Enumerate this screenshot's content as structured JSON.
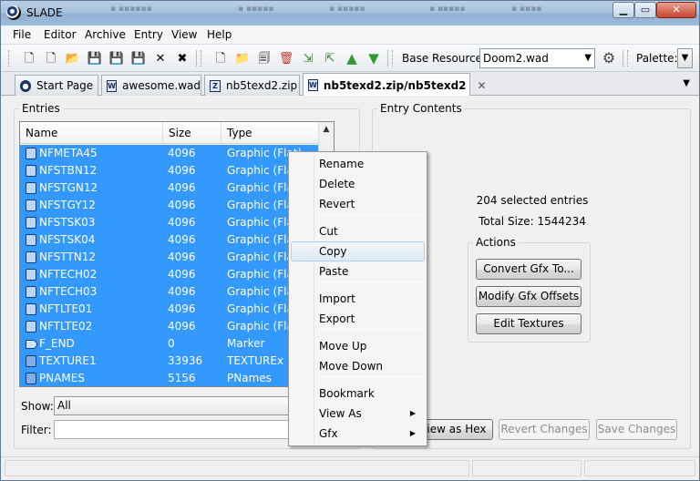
{
  "window": {
    "title": "SLADE"
  },
  "menu": [
    "File",
    "Editor",
    "Archive",
    "Entry",
    "View",
    "Help"
  ],
  "toolbar": {
    "base_resource_label": "Base Resource:",
    "base_resource_value": "Doom2.wad",
    "palette_label": "Palette:"
  },
  "tabs": [
    {
      "label": "Start Page"
    },
    {
      "label": "awesome.wad"
    },
    {
      "label": "nb5texd2.zip"
    },
    {
      "label": "nb5texd2.zip/nb5texd2",
      "close": "✕"
    }
  ],
  "entries": {
    "label": "Entries",
    "columns": [
      "Name",
      "Size",
      "Type"
    ],
    "rows": [
      {
        "name": "NFMETA45",
        "size": "4096",
        "type": "Graphic (Flat)",
        "icon": "graphic"
      },
      {
        "name": "NFSTBN12",
        "size": "4096",
        "type": "Graphic (Flat)",
        "icon": "graphic"
      },
      {
        "name": "NFSTGN12",
        "size": "4096",
        "type": "Graphic (Flat)",
        "icon": "graphic"
      },
      {
        "name": "NFSTGY12",
        "size": "4096",
        "type": "Graphic (Flat)",
        "icon": "graphic"
      },
      {
        "name": "NFSTSK03",
        "size": "4096",
        "type": "Graphic (Flat)",
        "icon": "graphic"
      },
      {
        "name": "NFSTSK04",
        "size": "4096",
        "type": "Graphic (Flat)",
        "icon": "graphic"
      },
      {
        "name": "NFSTTN12",
        "size": "4096",
        "type": "Graphic (Flat)",
        "icon": "graphic"
      },
      {
        "name": "NFTECH02",
        "size": "4096",
        "type": "Graphic (Flat)",
        "icon": "graphic"
      },
      {
        "name": "NFTECH03",
        "size": "4096",
        "type": "Graphic (Flat)",
        "icon": "graphic"
      },
      {
        "name": "NFTLTE01",
        "size": "4096",
        "type": "Graphic (Flat)",
        "icon": "graphic"
      },
      {
        "name": "NFTLTE02",
        "size": "4096",
        "type": "Graphic (Flat)",
        "icon": "graphic"
      },
      {
        "name": "F_END",
        "size": "0",
        "type": "Marker",
        "icon": "marker"
      },
      {
        "name": "TEXTURE1",
        "size": "33936",
        "type": "TEXTUREx",
        "icon": "texture"
      },
      {
        "name": "PNAMES",
        "size": "5156",
        "type": "PNames",
        "icon": "texture"
      }
    ],
    "show_label": "Show:",
    "show_value": "All",
    "filter_label": "Filter:"
  },
  "contents": {
    "label": "Entry Contents",
    "selected_text": "204 selected entries",
    "total_size_text": "Total Size: 1544234",
    "actions_label": "Actions",
    "actions": [
      "Convert Gfx To...",
      "Modify Gfx Offsets",
      "Edit Textures"
    ],
    "view_hex": "View as Hex",
    "revert_changes": "Revert Changes",
    "save_changes": "Save Changes"
  },
  "context_menu": {
    "items": [
      {
        "label": "Rename"
      },
      {
        "label": "Delete"
      },
      {
        "label": "Revert"
      },
      {
        "label": "Cut"
      },
      {
        "label": "Copy"
      },
      {
        "label": "Paste"
      },
      {
        "label": "Import"
      },
      {
        "label": "Export"
      },
      {
        "label": "Move Up"
      },
      {
        "label": "Move Down"
      },
      {
        "label": "Bookmark"
      },
      {
        "label": "View As"
      },
      {
        "label": "Gfx"
      }
    ]
  },
  "colors": {
    "selection": "#3399ff",
    "menu_hover": "#dfeaf7"
  }
}
